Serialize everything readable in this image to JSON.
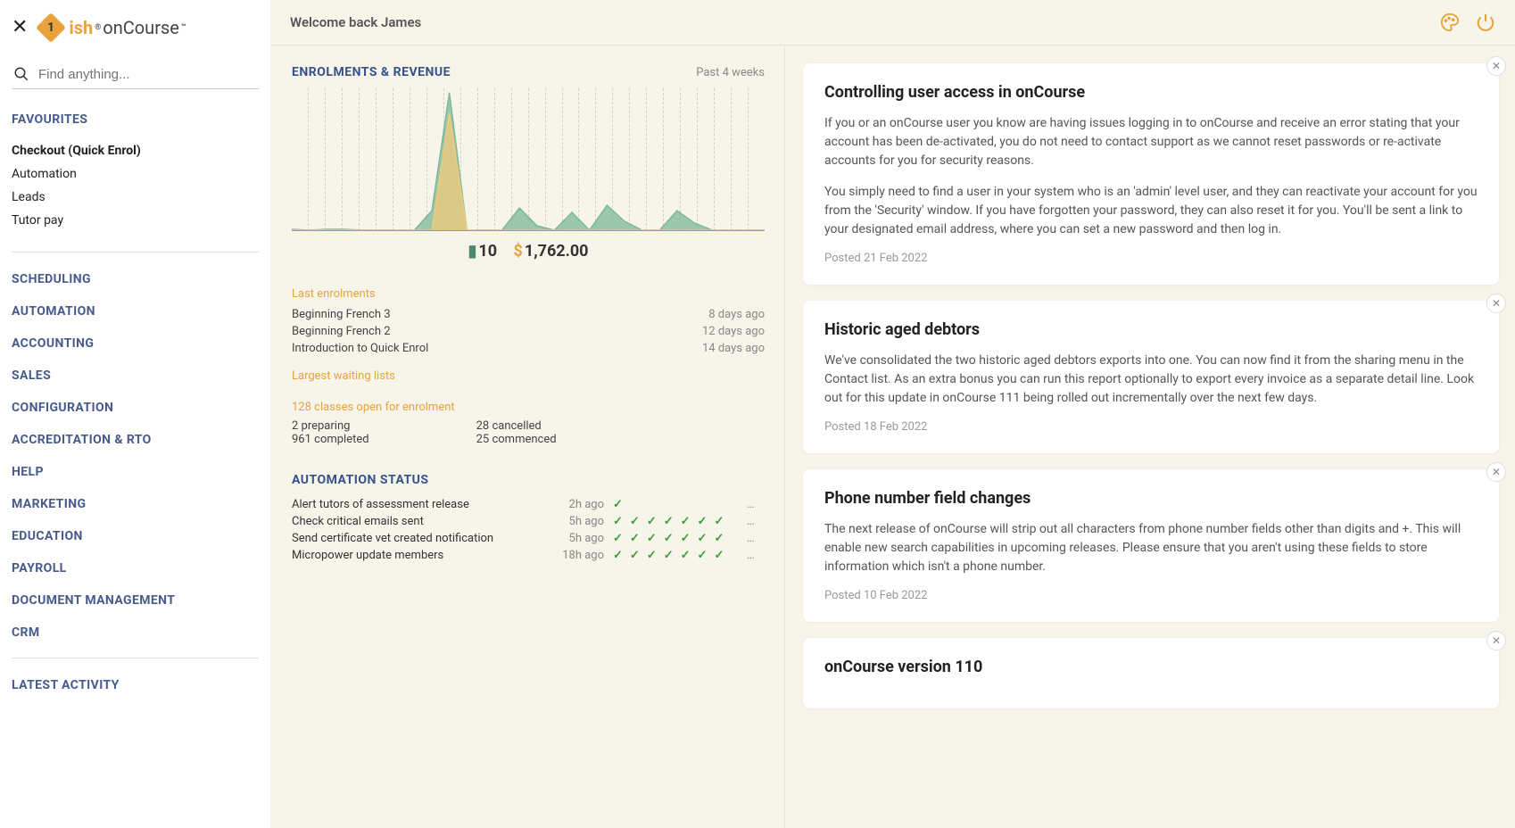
{
  "header": {
    "welcome": "Welcome back James",
    "logo_orange": "ish",
    "logo_dark": "onCourse"
  },
  "search": {
    "placeholder": "Find anything..."
  },
  "favourites": {
    "heading": "FAVOURITES",
    "items": [
      "Checkout (Quick Enrol)",
      "Automation",
      "Leads",
      "Tutor pay"
    ]
  },
  "nav_categories": [
    "SCHEDULING",
    "AUTOMATION",
    "ACCOUNTING",
    "SALES",
    "CONFIGURATION",
    "ACCREDITATION & RTO",
    "HELP",
    "MARKETING",
    "EDUCATION",
    "PAYROLL",
    "DOCUMENT MANAGEMENT",
    "CRM"
  ],
  "latest_activity_heading": "LATEST ACTIVITY",
  "enrolments": {
    "title": "ENROLMENTS & REVENUE",
    "period": "Past 4 weeks",
    "count": "10",
    "revenue": "1,762.00",
    "last_heading": "Last enrolments",
    "last": [
      {
        "name": "Beginning French 3",
        "ago": "8 days ago"
      },
      {
        "name": "Beginning French 2",
        "ago": "12 days ago"
      },
      {
        "name": "Introduction to Quick Enrol",
        "ago": "14 days ago"
      }
    ],
    "waiting_heading": "Largest waiting lists",
    "open_heading": "128 classes open for enrolment",
    "col1": [
      "2 preparing",
      "961 completed"
    ],
    "col2": [
      "28 cancelled",
      "25 commenced"
    ]
  },
  "automation": {
    "title": "AUTOMATION STATUS",
    "rows": [
      {
        "name": "Alert tutors of assessment release",
        "ago": "2h ago",
        "checks": 1
      },
      {
        "name": "Check critical emails sent",
        "ago": "5h ago",
        "checks": 7
      },
      {
        "name": "Send certificate vet created notification",
        "ago": "5h ago",
        "checks": 7
      },
      {
        "name": "Micropower update members",
        "ago": "18h ago",
        "checks": 7
      }
    ]
  },
  "chart_data": {
    "type": "area",
    "x": [
      0,
      1,
      2,
      3,
      4,
      5,
      6,
      7,
      8,
      9,
      10,
      11,
      12,
      13,
      14,
      15,
      16,
      17,
      18,
      19,
      20,
      21,
      22,
      23,
      24,
      25,
      26,
      27
    ],
    "series": [
      {
        "name": "revenue",
        "color": "#f0c97a",
        "values": [
          0,
          0,
          0,
          0,
          0,
          0,
          0,
          0,
          0,
          132,
          0,
          0,
          0,
          0,
          0,
          0,
          0,
          0,
          0,
          0,
          0,
          0,
          0,
          0,
          0,
          0,
          0,
          0
        ]
      },
      {
        "name": "enrolments",
        "color": "#7cb89a",
        "values": [
          1,
          0,
          1,
          1,
          0,
          0,
          0,
          0,
          22,
          155,
          0,
          0,
          0,
          25,
          5,
          0,
          20,
          0,
          28,
          10,
          0,
          0,
          22,
          8,
          0,
          0,
          0,
          0
        ]
      }
    ],
    "title": "Enrolments & Revenue — Past 4 weeks",
    "ylim": [
      0,
      160
    ]
  },
  "feed": [
    {
      "title": "Controlling user access in onCourse",
      "paras": [
        "If you or an onCourse user you know are having issues logging in to onCourse and receive an error stating that your account has been de-activated, you do not need to contact support as we cannot reset passwords or re-activate accounts for you for security reasons.",
        "You simply need to find a user in your system who is an 'admin' level user, and they can reactivate your account for you from the 'Security' window. If you have forgotten your password, they can also reset it for you. You'll be sent a link to your designated email address, where you can set a new password and then log in."
      ],
      "posted": "Posted 21 Feb 2022"
    },
    {
      "title": "Historic aged debtors",
      "paras": [
        "We've consolidated the two historic aged debtors exports into one. You can now find it from the sharing menu in the Contact list. As an extra bonus you can run this report optionally to export every invoice as a separate detail line. Look out for this update in onCourse 111 being rolled out incrementally over the next few days."
      ],
      "posted": "Posted 18 Feb 2022"
    },
    {
      "title": "Phone number field changes",
      "paras": [
        "The next release of onCourse will strip out all characters from phone number fields other than digits and +. This will enable new search capabilities in upcoming releases. Please ensure that you aren't using these fields to store information which isn't a phone number."
      ],
      "posted": "Posted 10 Feb 2022"
    },
    {
      "title": "onCourse version 110",
      "paras": [],
      "posted": ""
    }
  ]
}
